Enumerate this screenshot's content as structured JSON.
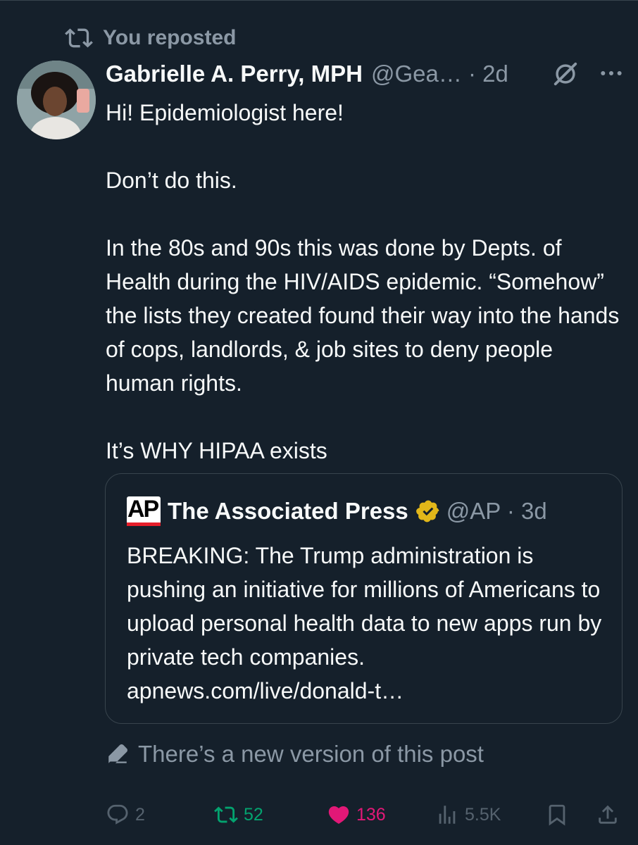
{
  "repost_banner": {
    "label": "You reposted"
  },
  "post": {
    "author_name": "Gabrielle A. Perry, MPH",
    "author_handle_time": "@Gea… · 2d",
    "paragraphs": [
      "Hi! Epidemiologist here!",
      "Don’t do this.",
      "In the 80s and 90s this was done by Depts. of Health during the HIV/AIDS epidemic. “Somehow” the lists they created found their way into the hands of cops, landlords, & job sites to deny people human rights.",
      "It’s WHY HIPAA exists"
    ]
  },
  "quoted_post": {
    "logo_text": "AP",
    "author_name": "The Associated Press",
    "author_handle_time": "@AP · 3d",
    "text": "BREAKING: The Trump administration is pushing an initiative for millions of Americans to upload personal health data to new apps run by private tech companies. apnews.com/live/donald-t…"
  },
  "edit_notice": {
    "label": "There’s a new version of this post"
  },
  "actions": {
    "replies": "2",
    "reposts": "52",
    "likes": "136",
    "views": "5.5K"
  },
  "icons": [
    "repost-icon",
    "grok-icon",
    "more-icon",
    "verified-badge-icon",
    "edit-pencil-icon",
    "reply-icon",
    "like-icon",
    "views-icon",
    "bookmark-icon",
    "share-icon"
  ],
  "colors": {
    "background": "#15202b",
    "text": "#f7f9f9",
    "secondary_text": "#8b98a5",
    "border": "#38444d",
    "repost_green": "#00ba7c",
    "like_pink": "#f91880",
    "verified_gold": "#e2b719",
    "ap_red": "#e61e2a"
  }
}
